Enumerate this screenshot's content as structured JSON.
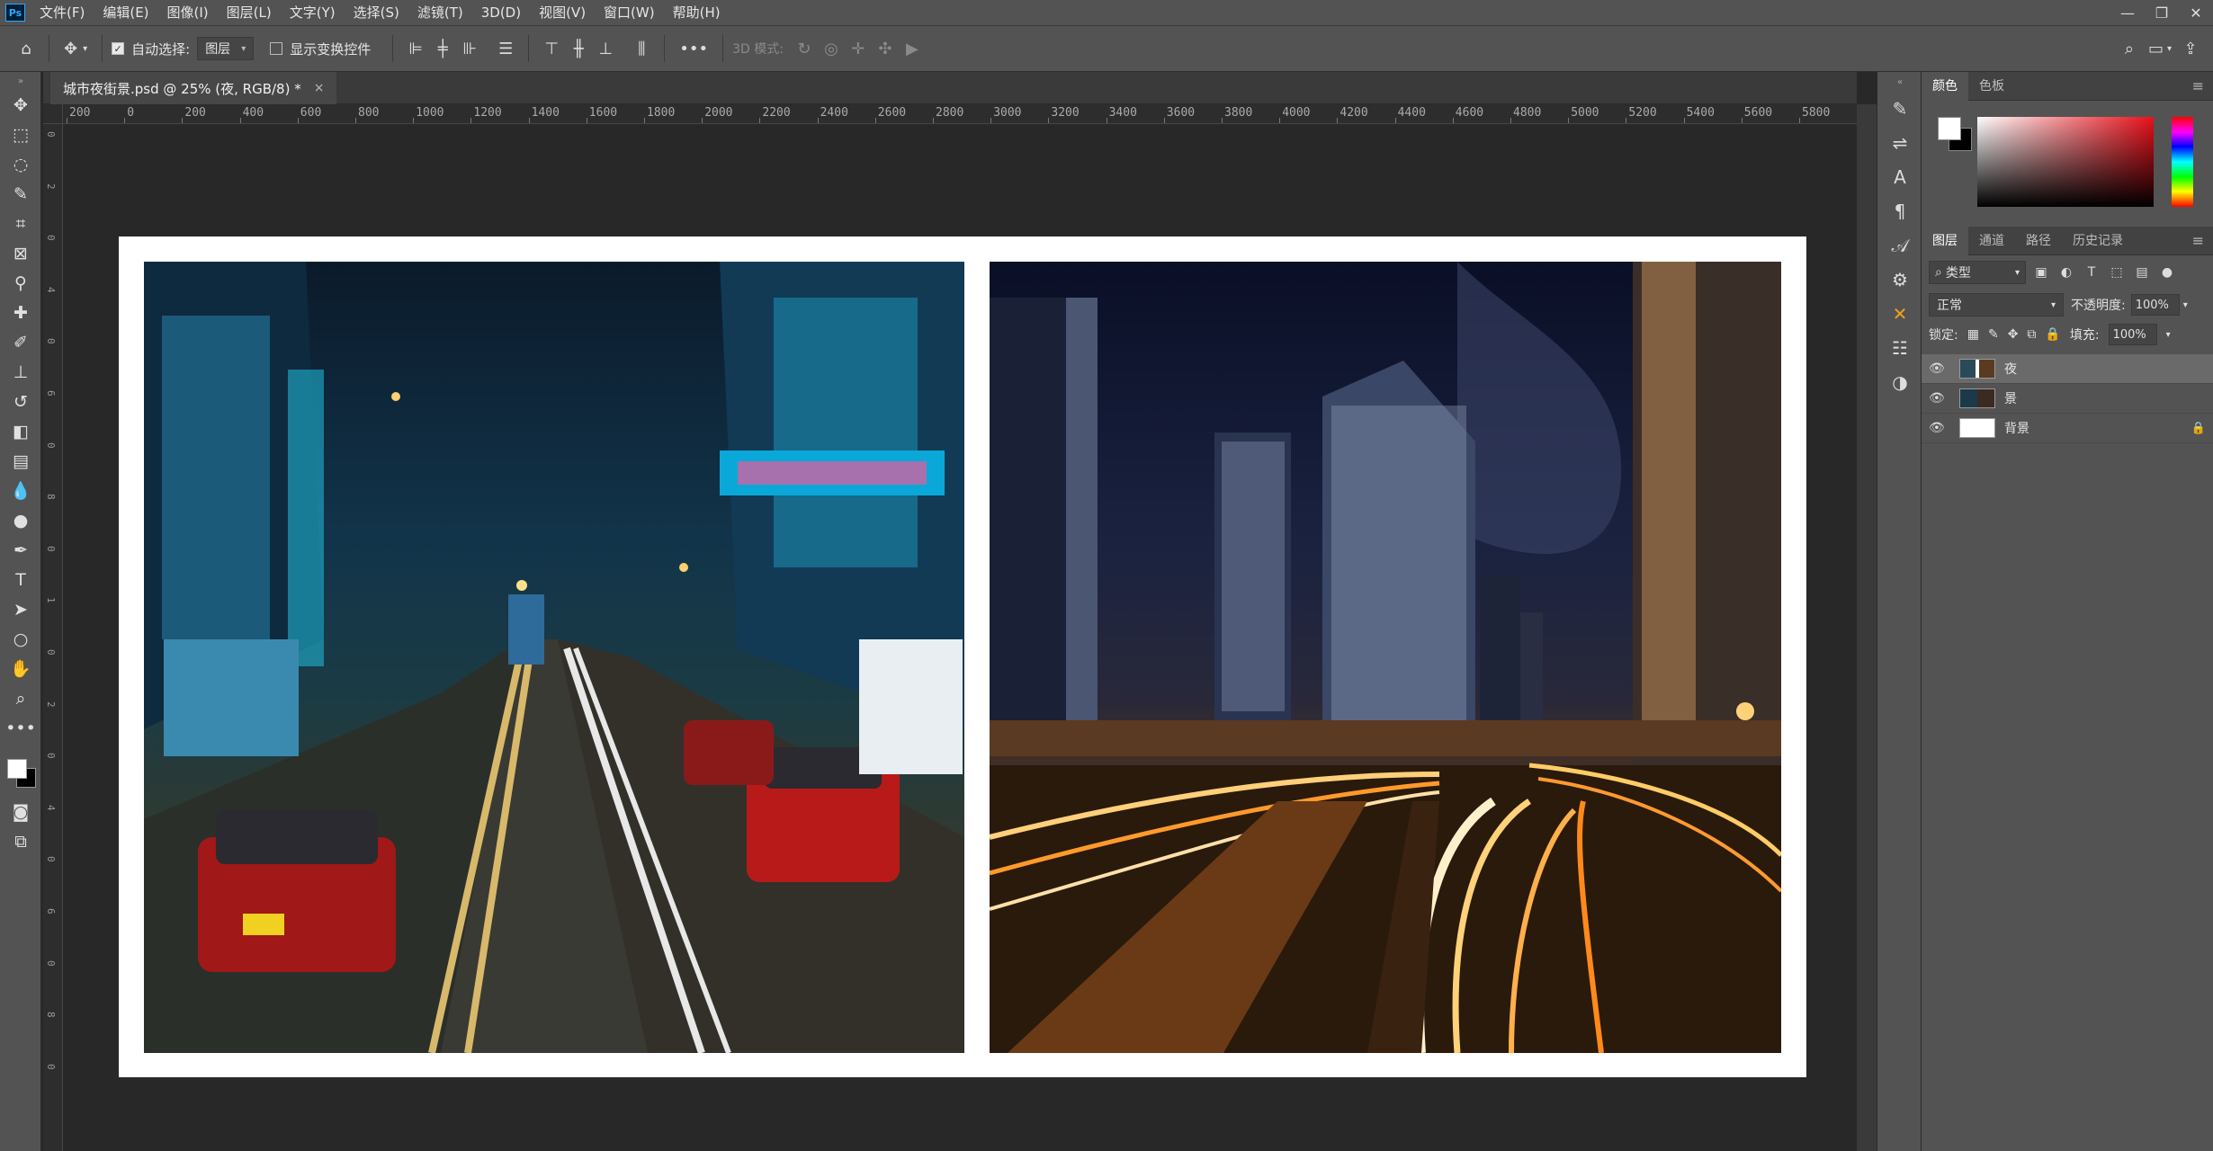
{
  "app": {
    "logo": "Ps"
  },
  "menu": [
    "文件(F)",
    "编辑(E)",
    "图像(I)",
    "图层(L)",
    "文字(Y)",
    "选择(S)",
    "滤镜(T)",
    "3D(D)",
    "视图(V)",
    "窗口(W)",
    "帮助(H)"
  ],
  "window_controls": {
    "minimize": "—",
    "restore": "❐",
    "close": "✕"
  },
  "options": {
    "auto_select_label": "自动选择:",
    "auto_select_value": "图层",
    "show_transform_label": "显示变换控件",
    "mode_3d_label": "3D 模式:"
  },
  "document": {
    "tab_title": "城市夜街景.psd @ 25% (夜, RGB/8) *",
    "close": "×"
  },
  "ruler_h": [
    "200",
    "0",
    "200",
    "400",
    "600",
    "800",
    "1000",
    "1200",
    "1400",
    "1600",
    "1800",
    "2000",
    "2200",
    "2400",
    "2600",
    "2800",
    "3000",
    "3200",
    "3400",
    "3600",
    "3800",
    "4000",
    "4200",
    "4400",
    "4600",
    "4800",
    "5000",
    "5200",
    "5400",
    "5600",
    "5800"
  ],
  "ruler_v": [
    "0",
    "2",
    "0",
    "4",
    "0",
    "6",
    "0",
    "8",
    "0",
    "1",
    "0",
    "2",
    "0",
    "4",
    "0",
    "6",
    "0",
    "8",
    "0"
  ],
  "color_panel": {
    "tabs": [
      "颜色",
      "色板"
    ],
    "foreground": "#ffffff",
    "background": "#000000"
  },
  "layers_panel": {
    "tabs": [
      "图层",
      "通道",
      "路径",
      "历史记录"
    ],
    "filter_label": "类型",
    "blend_mode": "正常",
    "opacity_label": "不透明度:",
    "opacity_value": "100%",
    "lock_label": "锁定:",
    "fill_label": "填充:",
    "fill_value": "100%",
    "layers": [
      {
        "name": "夜",
        "selected": true
      },
      {
        "name": "景",
        "selected": false
      },
      {
        "name": "背景",
        "selected": false,
        "locked": true
      }
    ]
  }
}
